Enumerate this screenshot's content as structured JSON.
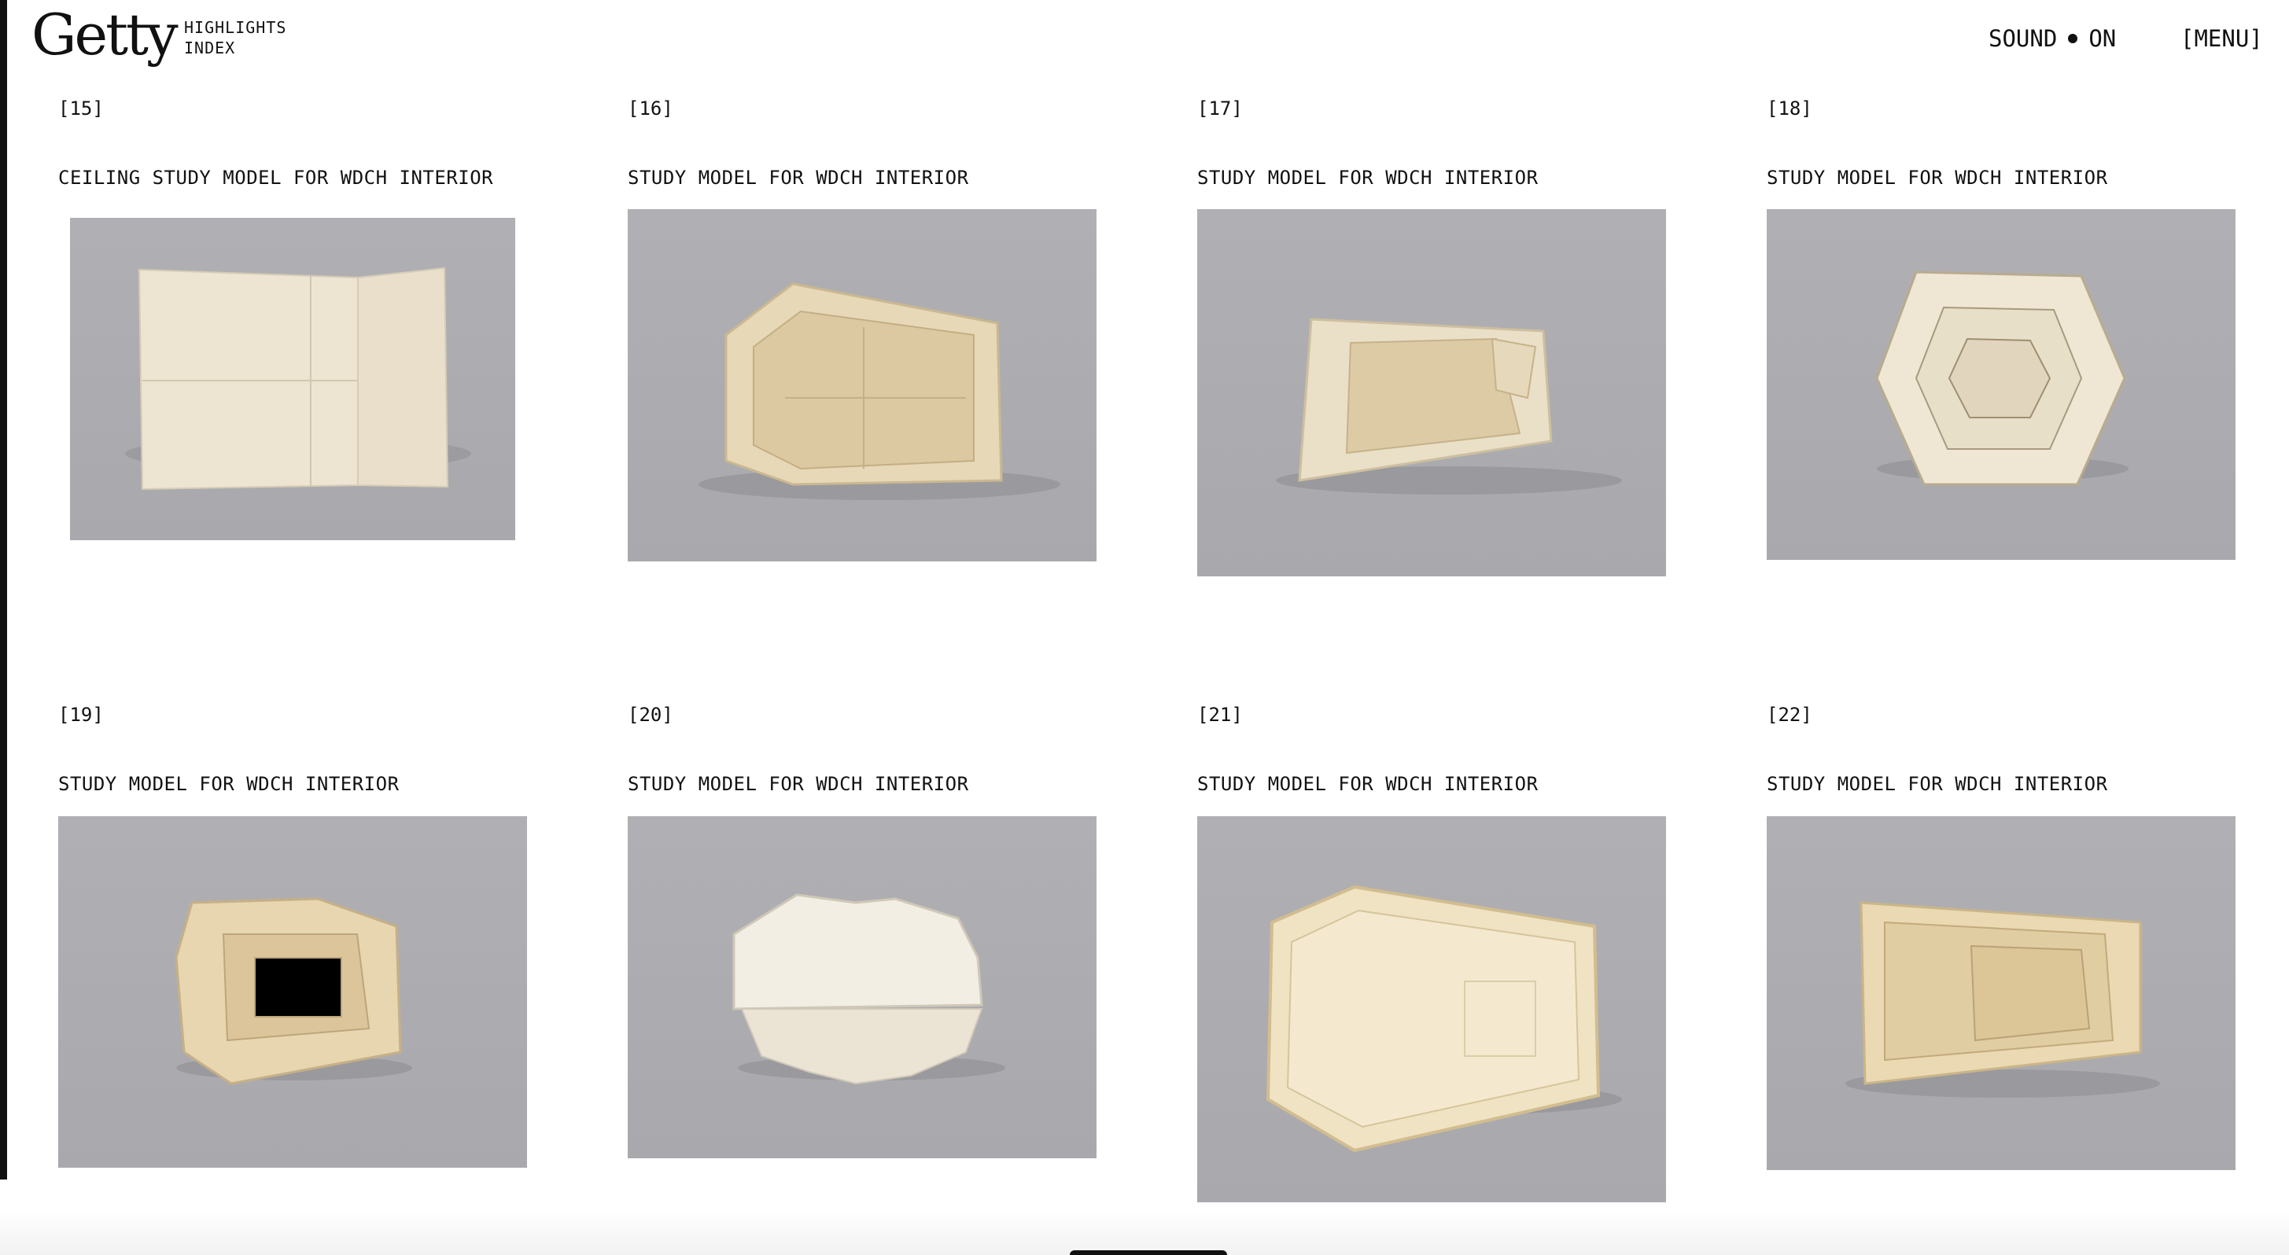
{
  "header": {
    "logo": "Getty",
    "nav": [
      "HIGHLIGHTS",
      "INDEX"
    ],
    "sound_label": "SOUND",
    "sound_state": "ON",
    "menu_label": "[MENU]"
  },
  "items": [
    {
      "number": "[15]",
      "title": "CEILING STUDY MODEL FOR WDCH INTERIOR"
    },
    {
      "number": "[16]",
      "title": "STUDY MODEL FOR WDCH INTERIOR"
    },
    {
      "number": "[17]",
      "title": "STUDY MODEL FOR WDCH INTERIOR"
    },
    {
      "number": "[18]",
      "title": "STUDY MODEL FOR WDCH INTERIOR"
    },
    {
      "number": "[19]",
      "title": "STUDY MODEL FOR WDCH INTERIOR"
    },
    {
      "number": "[20]",
      "title": "STUDY MODEL FOR WDCH INTERIOR"
    },
    {
      "number": "[21]",
      "title": "STUDY MODEL FOR WDCH INTERIOR"
    },
    {
      "number": "[22]",
      "title": "STUDY MODEL FOR WDCH INTERIOR"
    }
  ],
  "colors": {
    "background": "#ffffff",
    "text": "#111111",
    "photo_backdrop": "#adadb1",
    "model_paper": "#efe6d2"
  }
}
